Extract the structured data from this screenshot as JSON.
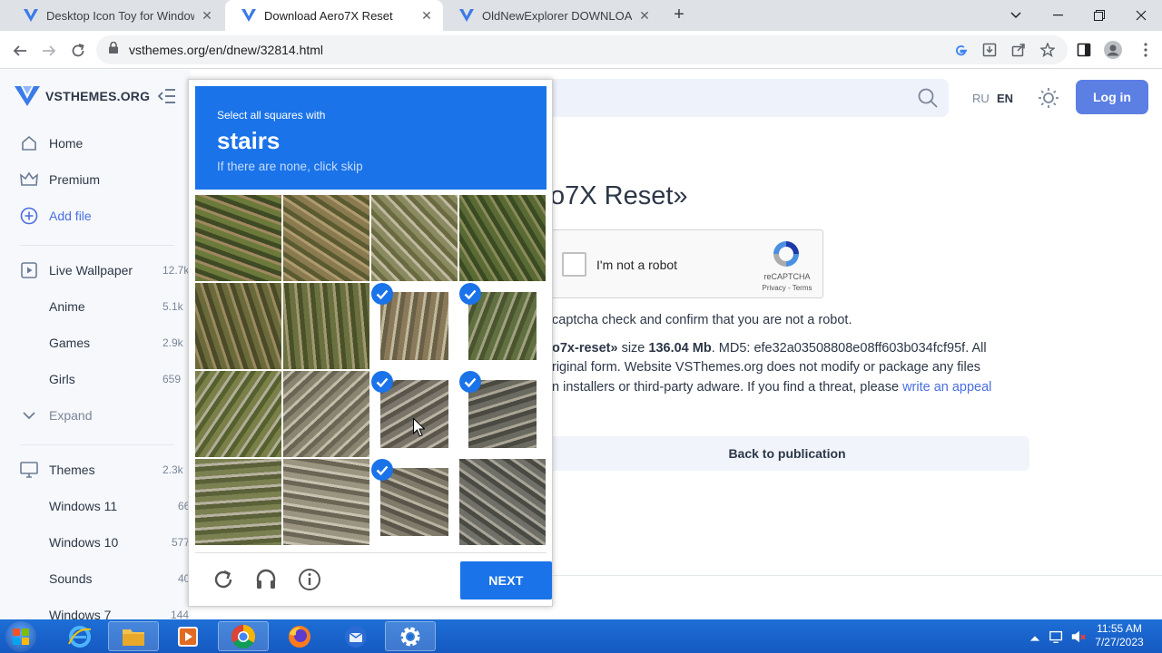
{
  "browser": {
    "tabs": [
      {
        "title": "Desktop Icon Toy for Windows - D",
        "active": false
      },
      {
        "title": "Download Aero7X Reset",
        "active": true
      },
      {
        "title": "OldNewExplorer DOWNLOAD FR",
        "active": false
      }
    ],
    "url": "vsthemes.org/en/dnew/32814.html"
  },
  "site": {
    "logo_text": "VSTHEMES.ORG",
    "lang_ru": "RU",
    "lang_en": "EN",
    "login_label": "Log in",
    "sidebar": [
      {
        "label": "Home",
        "count": ""
      },
      {
        "label": "Premium",
        "count": ""
      },
      {
        "label": "Add file",
        "count": ""
      },
      {
        "label": "Live Wallpaper",
        "count": "12.7k"
      },
      {
        "label": "Anime",
        "count": "5.1k"
      },
      {
        "label": "Games",
        "count": "2.9k"
      },
      {
        "label": "Girls",
        "count": "659"
      },
      {
        "label": "Expand",
        "count": ""
      },
      {
        "label": "Themes",
        "count": "2.3k"
      },
      {
        "label": "Windows 11",
        "count": "66"
      },
      {
        "label": "Windows 10",
        "count": "577"
      },
      {
        "label": "Sounds",
        "count": "40"
      },
      {
        "label": "Windows 7",
        "count": "144"
      }
    ],
    "page_title": "o7X Reset»",
    "recaptcha": {
      "label": "I'm not a robot",
      "brand": "reCAPTCHA",
      "links": "Privacy - Terms"
    },
    "text": {
      "line1": "captcha check and confirm that you are not a robot.",
      "line2_a": "o7x-reset»",
      "line2_b": " size ",
      "line2_c": "136.04 Mb",
      "line2_d": ". MD5: efe32a03508808e08ff603b034fcf95f. All",
      "line3": "riginal form. Website VSThemes.org does not modify or package any files",
      "line4_a": "n installers or third-party adware. If you find a threat, please ",
      "line4_link": "write an appeal"
    },
    "back_label": "Back to publication"
  },
  "captcha": {
    "instruction": "Select all squares with",
    "target": "stairs",
    "subtext": "If there are none, click skip",
    "selected": [
      false,
      false,
      false,
      false,
      false,
      false,
      true,
      true,
      false,
      false,
      true,
      true,
      false,
      false,
      true,
      false
    ],
    "next_label": "NEXT"
  },
  "taskbar": {
    "time": "11:55 AM",
    "date": "7/27/2023"
  },
  "colors": {
    "captcha_blue": "#1a73e8",
    "login_blue": "#5b7fe3",
    "taskbar_blue": "#1d6fd6"
  }
}
